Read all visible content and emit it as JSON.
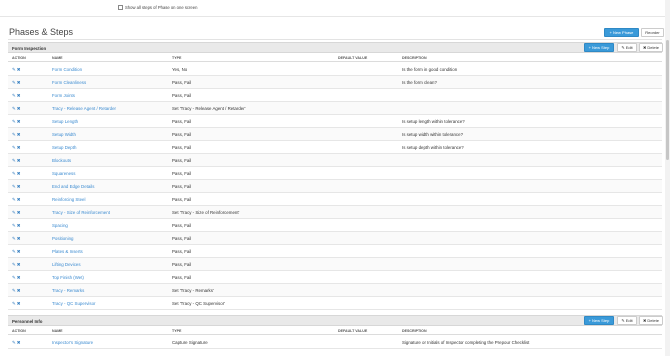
{
  "topbar": {
    "show_all_label": "Show all steps of Phase on one screen"
  },
  "page": {
    "title": "Phases & Steps"
  },
  "toolbar": {
    "new_phase": "New Phase",
    "reorder": "Reorder"
  },
  "columns": {
    "action": "ACTION",
    "name": "NAME",
    "type": "TYPE",
    "default_value": "DEFAULT VALUE",
    "description": "DESCRIPTION"
  },
  "phase_buttons": {
    "new_step": "New Step",
    "edit": "Edit",
    "delete": "Delete"
  },
  "sections": [
    {
      "title": "Form Inspection",
      "rows": [
        {
          "name": "Form Condition",
          "type": "Yes, No",
          "default": "",
          "description": "Is the form in good condition"
        },
        {
          "name": "Form Cleanliness",
          "type": "Pass, Fail",
          "default": "",
          "description": "Is the form clean?"
        },
        {
          "name": "Form Joints",
          "type": "Pass, Fail",
          "default": "",
          "description": ""
        },
        {
          "name": "Tracy - Release Agent / Retarder",
          "type": "Set 'Tracy - Release Agent / Retarder'",
          "default": "",
          "description": ""
        },
        {
          "name": "Setup Length",
          "type": "Pass, Fail",
          "default": "",
          "description": "Is setup length within tolerance?"
        },
        {
          "name": "Setup Width",
          "type": "Pass, Fail",
          "default": "",
          "description": "Is setup width within tolerance?"
        },
        {
          "name": "Setup Depth",
          "type": "Pass, Fail",
          "default": "",
          "description": "Is setup depth within tolerance?"
        },
        {
          "name": "Blockouts",
          "type": "Pass, Fail",
          "default": "",
          "description": ""
        },
        {
          "name": "Squareness",
          "type": "Pass, Fail",
          "default": "",
          "description": ""
        },
        {
          "name": "End and Edge Details",
          "type": "Pass, Fail",
          "default": "",
          "description": ""
        },
        {
          "name": "Reinforcing Steel",
          "type": "Pass, Fail",
          "default": "",
          "description": ""
        },
        {
          "name": "Tracy - Size of Reinforcement",
          "type": "Set 'Tracy - Size of Reinforcement'",
          "default": "",
          "description": ""
        },
        {
          "name": "Spacing",
          "type": "Pass, Fail",
          "default": "",
          "description": ""
        },
        {
          "name": "Positioning",
          "type": "Pass, Fail",
          "default": "",
          "description": ""
        },
        {
          "name": "Plates & Inserts",
          "type": "Pass, Fail",
          "default": "",
          "description": ""
        },
        {
          "name": "Lifting Devices",
          "type": "Pass, Fail",
          "default": "",
          "description": ""
        },
        {
          "name": "Top Finish (Wet)",
          "type": "Pass, Fail",
          "default": "",
          "description": ""
        },
        {
          "name": "Tracy - Remarks",
          "type": "Set 'Tracy - Remarks'",
          "default": "",
          "description": ""
        },
        {
          "name": "Tracy - QC Supervisor",
          "type": "Set 'Tracy - QC Supervisor'",
          "default": "",
          "description": ""
        }
      ]
    },
    {
      "title": "Personnel Info",
      "rows": [
        {
          "name": "Inspector's Signature",
          "type": "Capture Signature",
          "default": "",
          "description": "Signature or Initials of Inspector completing the Prepour Checklist"
        }
      ]
    }
  ],
  "colors": {
    "accent": "#3a9ad9",
    "link": "#3a8ad0",
    "section_bg": "#e9e9e9"
  }
}
